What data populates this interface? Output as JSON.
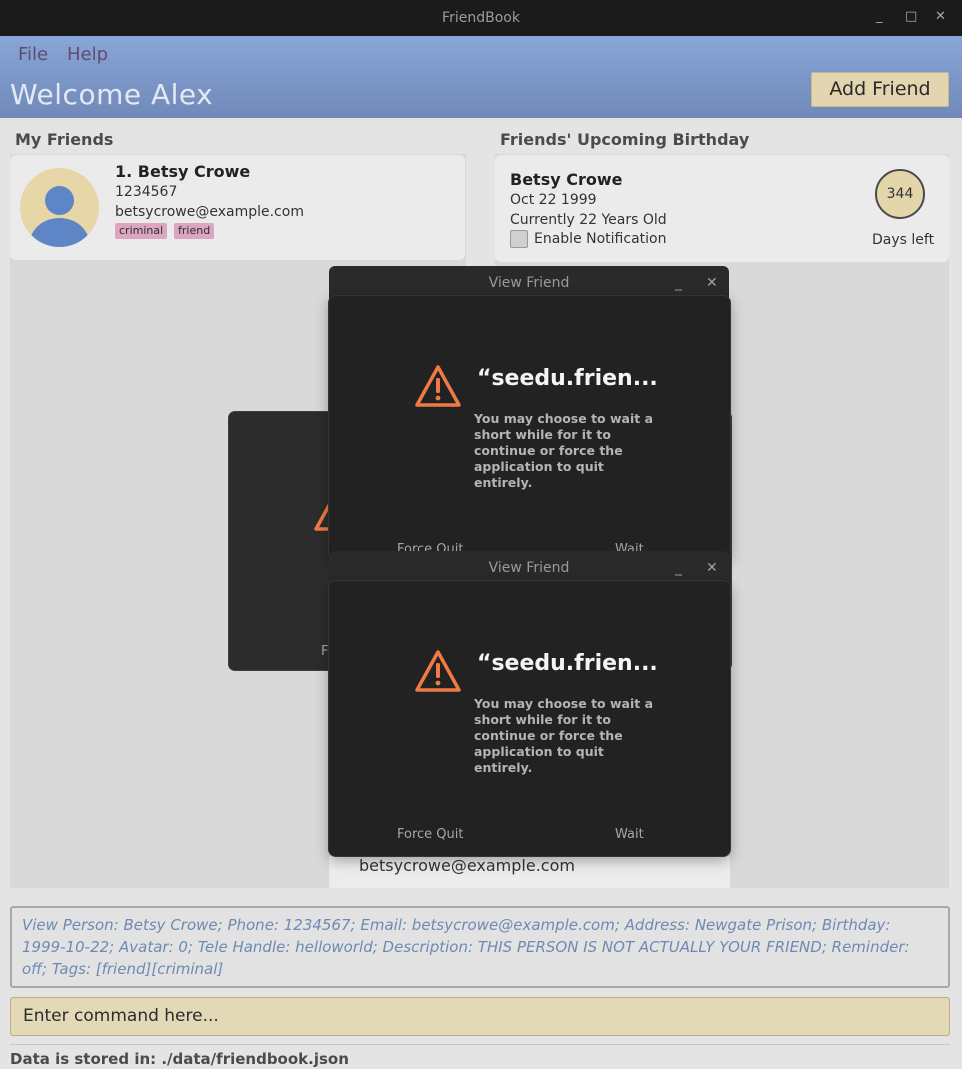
{
  "app": {
    "title": "FriendBook",
    "window_controls": [
      "_",
      "□",
      "✕"
    ]
  },
  "menu": {
    "file": "File",
    "help": "Help"
  },
  "header": {
    "welcome": "Welcome Alex",
    "add_friend_label": "Add Friend"
  },
  "friends": {
    "title": "My Friends",
    "items": [
      {
        "name": "1. Betsy Crowe",
        "phone": "1234567",
        "email": "betsycrowe@example.com",
        "tags": [
          "criminal",
          "friend"
        ]
      }
    ]
  },
  "birthdays": {
    "title": "Friends' Upcoming Birthday",
    "items": [
      {
        "name": "Betsy Crowe",
        "date": "Oct 22 1999",
        "age": "Currently 22 Years Old",
        "notification_label": "Enable Notification",
        "notification_enabled": false,
        "days": "344",
        "days_label": "Days left"
      }
    ]
  },
  "view_friend_windows": [
    {
      "title": "View Friend",
      "controls": [
        "_",
        "✕"
      ]
    },
    {
      "title": "View Friend",
      "controls": [
        "_",
        "✕"
      ]
    }
  ],
  "dialogs": [
    {
      "title": "“seedu.frien...",
      "message": "You may choose to wait a short while for it to continue or force the application to quit entirely.",
      "force_quit": "Force Quit",
      "wait": "Wait"
    },
    {
      "title": "“seedu.frien...",
      "message": "You may choose to wait a short while for it to continue or force the application to quit entirely.",
      "force_quit": "Force Quit",
      "wait": "Wait"
    }
  ],
  "view_friend_email": "betsycrowe@example.com",
  "result_text": "View Person: Betsy Crowe; Phone: 1234567; Email: betsycrowe@example.com; Address: Newgate Prison; Birthday: 1999-10-22; Avatar: 0; Tele Handle: helloworld; Description: THIS PERSON IS NOT ACTUALLY YOUR FRIEND; Reminder: off; Tags: [friend][criminal]",
  "command": {
    "placeholder": "Enter command here..."
  },
  "status": "Data is stored in: ./data/friendbook.json",
  "colors": {
    "header": "#7f9bcc",
    "accent_button": "#e2d5b0",
    "tag": "#dca5c0",
    "dialog_bg": "#222222",
    "warning": "#f07a44"
  }
}
